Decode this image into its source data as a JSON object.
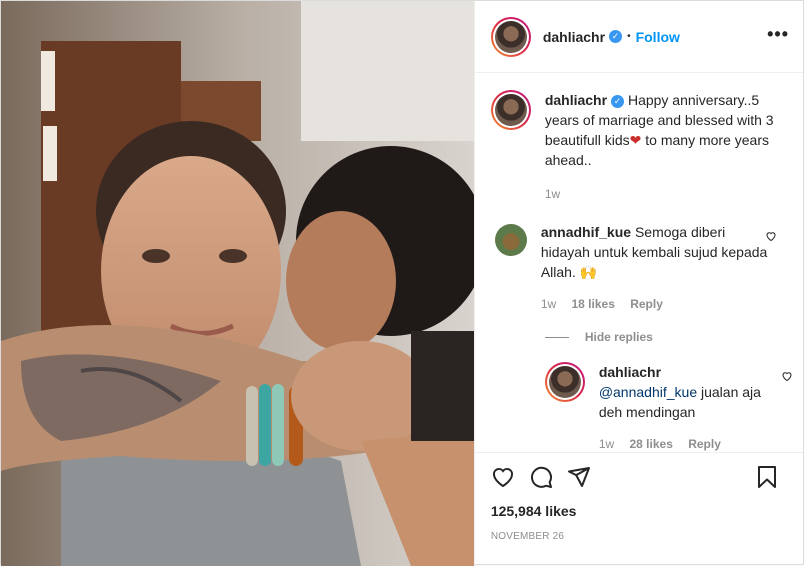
{
  "post": {
    "username": "dahliachr",
    "follow_label": "Follow",
    "more_label": "•••",
    "verified_mark": "✓"
  },
  "caption": {
    "username": "dahliachr",
    "text_before": "Happy anniversary..5 years of marriage and blessed with 3 beautifull kids",
    "emoji": "❤",
    "text_after": " to many more years ahead..",
    "time": "1w"
  },
  "comments": [
    {
      "username": "annadhif_kue",
      "text": "Semoga diberi hidayah untuk kembali sujud kepada Allah.",
      "emoji": "🙌",
      "time": "1w",
      "likes": "18 likes",
      "reply_label": "Reply"
    }
  ],
  "hide_replies_label": "Hide replies",
  "replies": [
    {
      "username": "dahliachr",
      "mention": "@annadhif_kue",
      "text": " jualan aja deh mendingan",
      "time": "1w",
      "likes": "28 likes",
      "reply_label": "Reply"
    }
  ],
  "likes_count": "125,984 likes",
  "date": "NOVEMBER 26",
  "icons": {
    "like": "heart-icon",
    "comment": "comment-icon",
    "share": "share-icon",
    "save": "bookmark-icon",
    "more": "more-options-icon"
  },
  "colors": {
    "link": "#0095f6",
    "verified": "#3897f0",
    "secondary_text": "#8e8e8e",
    "heart_emoji": "#c9302c"
  }
}
